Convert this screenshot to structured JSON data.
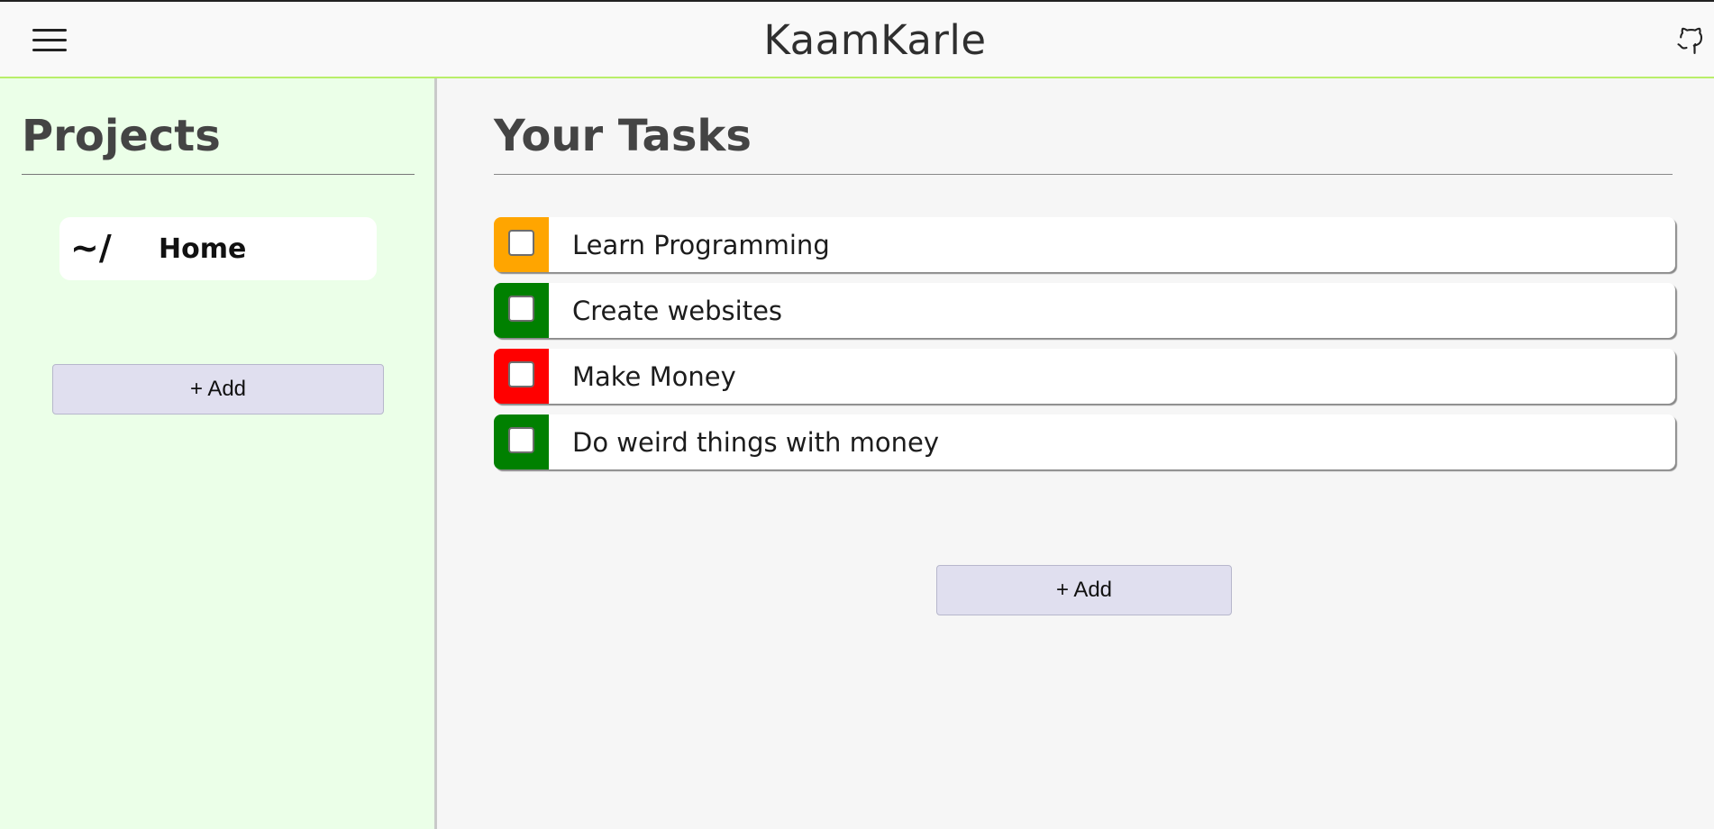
{
  "header": {
    "title": "KaamKarle",
    "menu_icon": "hamburger-menu-icon",
    "github_icon": "github-icon"
  },
  "sidebar": {
    "title": "Projects",
    "projects": [
      {
        "prefix": "~/",
        "name": "Home"
      }
    ],
    "add_label": "+ Add"
  },
  "main": {
    "title": "Your Tasks",
    "tasks": [
      {
        "text": "Learn Programming",
        "priority_color": "#ffa500"
      },
      {
        "text": "Create websites",
        "priority_color": "#008000"
      },
      {
        "text": "Make Money",
        "priority_color": "#ff0000"
      },
      {
        "text": "Do weird things with money",
        "priority_color": "#008000"
      }
    ],
    "add_label": "+ Add"
  },
  "colors": {
    "sidebar_bg": "#ebffe8",
    "header_accent": "#b9ef6a",
    "add_button_bg": "#e0dfef"
  }
}
